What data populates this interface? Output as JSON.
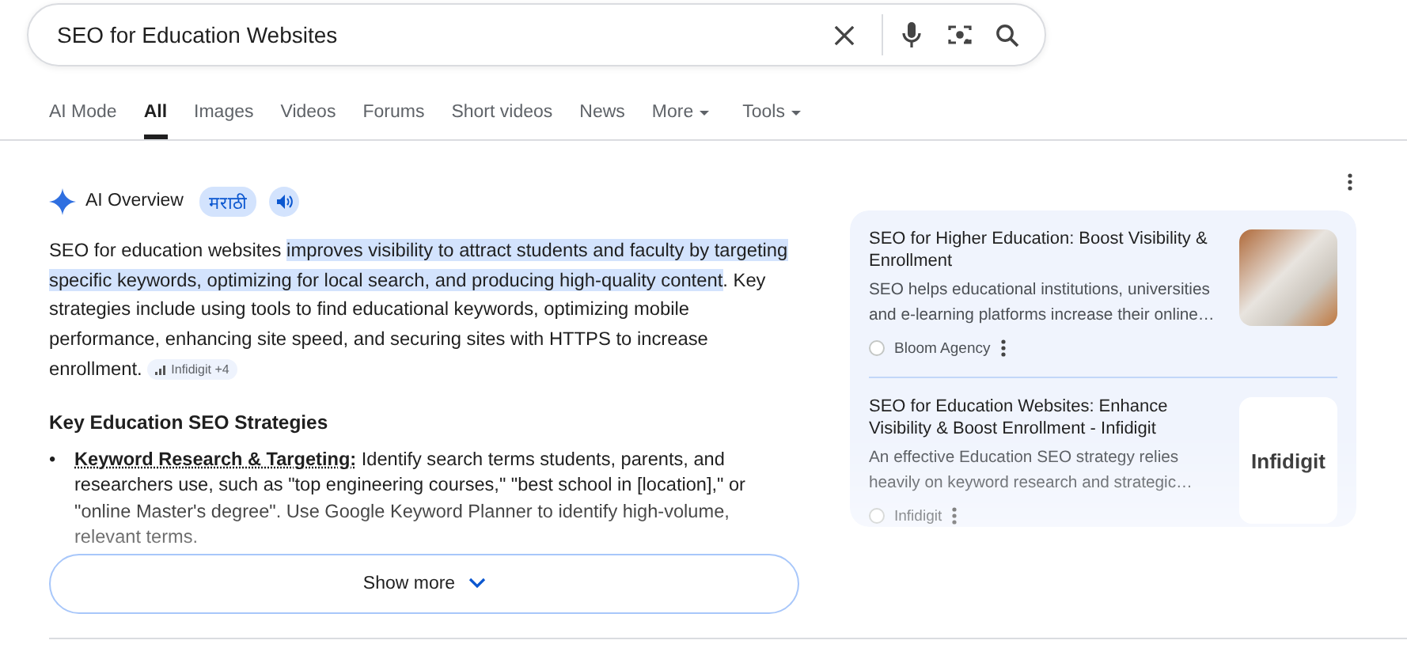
{
  "search": {
    "value": "SEO for Education Websites"
  },
  "tabs": [
    {
      "label": "AI Mode",
      "selected": false,
      "kind": "plain"
    },
    {
      "label": "All",
      "selected": true,
      "kind": "plain"
    },
    {
      "label": "Images",
      "selected": false,
      "kind": "plain"
    },
    {
      "label": "Videos",
      "selected": false,
      "kind": "plain"
    },
    {
      "label": "Forums",
      "selected": false,
      "kind": "plain"
    },
    {
      "label": "Short videos",
      "selected": false,
      "kind": "plain"
    },
    {
      "label": "News",
      "selected": false,
      "kind": "plain"
    },
    {
      "label": "More",
      "selected": false,
      "kind": "menu"
    },
    {
      "label": "Tools",
      "selected": false,
      "kind": "menu"
    }
  ],
  "ai_overview": {
    "title": "AI Overview",
    "language": "मराठी",
    "summary": [
      {
        "text": "SEO for education websites ",
        "highlighted": false
      },
      {
        "text": "improves visibility to attract students and faculty by targeting specific keywords, optimizing for local search, and producing high-quality content",
        "highlighted": true
      },
      {
        "text": ". Key strategies include using tools to find educational keywords, optimizing mobile performance, enhancing site speed, and securing sites with HTTPS to increase enrollment.",
        "highlighted": false
      }
    ],
    "source_chip": "Infidigit +4",
    "heading": "Key Education SEO Strategies",
    "bullets": [
      {
        "marker": "•",
        "term": "Keyword Research & Targeting:",
        "text": "Identify search terms students, parents, and researchers use, such as \"top engineering courses,\" \"best school in [location],\" or \"online Master's degree\". Use Google Keyword Planner to identify high-volume, relevant terms."
      }
    ],
    "show_more": "Show more"
  },
  "sources": [
    {
      "title": "SEO for Higher Education: Boost Visibility & Enrollment",
      "snippet": "SEO helps educational institutions, universities and e-learning platforms increase their online…",
      "site": "Bloom Agency",
      "kind": "photo"
    },
    {
      "title": "SEO for Education Websites: Enhance Visibility & Boost Enrollment - Infidigit",
      "snippet": "An effective Education SEO strategy relies heavily on keyword research and strategic…",
      "site": "Infidigit",
      "kind": "logo",
      "logo_text": "Infidigit"
    }
  ]
}
